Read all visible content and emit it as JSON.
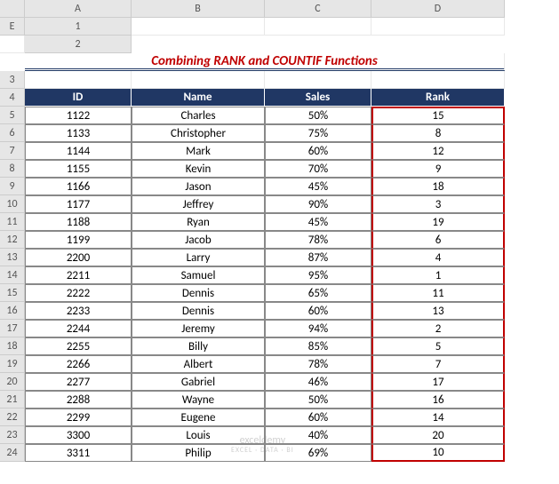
{
  "columns": [
    "A",
    "B",
    "C",
    "D",
    "E"
  ],
  "row_start": 1,
  "row_end": 24,
  "title": "Combining RANK and COUNTIF Functions",
  "headers": {
    "id": "ID",
    "name": "Name",
    "sales": "Sales",
    "rank": "Rank"
  },
  "rows": [
    {
      "id": "1122",
      "name": "Charles",
      "sales": "50%",
      "rank": "15"
    },
    {
      "id": "1133",
      "name": "Christopher",
      "sales": "75%",
      "rank": "8"
    },
    {
      "id": "1144",
      "name": "Mark",
      "sales": "60%",
      "rank": "12"
    },
    {
      "id": "1155",
      "name": "Kevin",
      "sales": "70%",
      "rank": "9"
    },
    {
      "id": "1166",
      "name": "Jason",
      "sales": "45%",
      "rank": "18"
    },
    {
      "id": "1177",
      "name": "Jeffrey",
      "sales": "90%",
      "rank": "3"
    },
    {
      "id": "1188",
      "name": "Ryan",
      "sales": "45%",
      "rank": "19"
    },
    {
      "id": "1199",
      "name": "Jacob",
      "sales": "78%",
      "rank": "6"
    },
    {
      "id": "2200",
      "name": "Larry",
      "sales": "87%",
      "rank": "4"
    },
    {
      "id": "2211",
      "name": "Samuel",
      "sales": "95%",
      "rank": "1"
    },
    {
      "id": "2222",
      "name": "Dennis",
      "sales": "65%",
      "rank": "11"
    },
    {
      "id": "2233",
      "name": "Dennis",
      "sales": "60%",
      "rank": "13"
    },
    {
      "id": "2244",
      "name": "Jeremy",
      "sales": "94%",
      "rank": "2"
    },
    {
      "id": "2255",
      "name": "Billy",
      "sales": "85%",
      "rank": "5"
    },
    {
      "id": "2266",
      "name": "Albert",
      "sales": "78%",
      "rank": "7"
    },
    {
      "id": "2277",
      "name": "Gabriel",
      "sales": "46%",
      "rank": "17"
    },
    {
      "id": "2288",
      "name": "Wayne",
      "sales": "50%",
      "rank": "16"
    },
    {
      "id": "2299",
      "name": "Eugene",
      "sales": "60%",
      "rank": "14"
    },
    {
      "id": "3300",
      "name": "Louis",
      "sales": "40%",
      "rank": "20"
    },
    {
      "id": "3311",
      "name": "Philip",
      "sales": "69%",
      "rank": "10"
    }
  ],
  "watermark": {
    "main": "exceldemy",
    "sub": "EXCEL · DATA · BI"
  },
  "chart_data": {
    "type": "table",
    "title": "Combining RANK and COUNTIF Functions",
    "columns": [
      "ID",
      "Name",
      "Sales",
      "Rank"
    ],
    "data": [
      [
        1122,
        "Charles",
        0.5,
        15
      ],
      [
        1133,
        "Christopher",
        0.75,
        8
      ],
      [
        1144,
        "Mark",
        0.6,
        12
      ],
      [
        1155,
        "Kevin",
        0.7,
        9
      ],
      [
        1166,
        "Jason",
        0.45,
        18
      ],
      [
        1177,
        "Jeffrey",
        0.9,
        3
      ],
      [
        1188,
        "Ryan",
        0.45,
        19
      ],
      [
        1199,
        "Jacob",
        0.78,
        6
      ],
      [
        2200,
        "Larry",
        0.87,
        4
      ],
      [
        2211,
        "Samuel",
        0.95,
        1
      ],
      [
        2222,
        "Dennis",
        0.65,
        11
      ],
      [
        2233,
        "Dennis",
        0.6,
        13
      ],
      [
        2244,
        "Jeremy",
        0.94,
        2
      ],
      [
        2255,
        "Billy",
        0.85,
        5
      ],
      [
        2266,
        "Albert",
        0.78,
        7
      ],
      [
        2277,
        "Gabriel",
        0.46,
        17
      ],
      [
        2288,
        "Wayne",
        0.5,
        16
      ],
      [
        2299,
        "Eugene",
        0.6,
        14
      ],
      [
        3300,
        "Louis",
        0.4,
        20
      ],
      [
        3311,
        "Philip",
        0.69,
        10
      ]
    ]
  }
}
